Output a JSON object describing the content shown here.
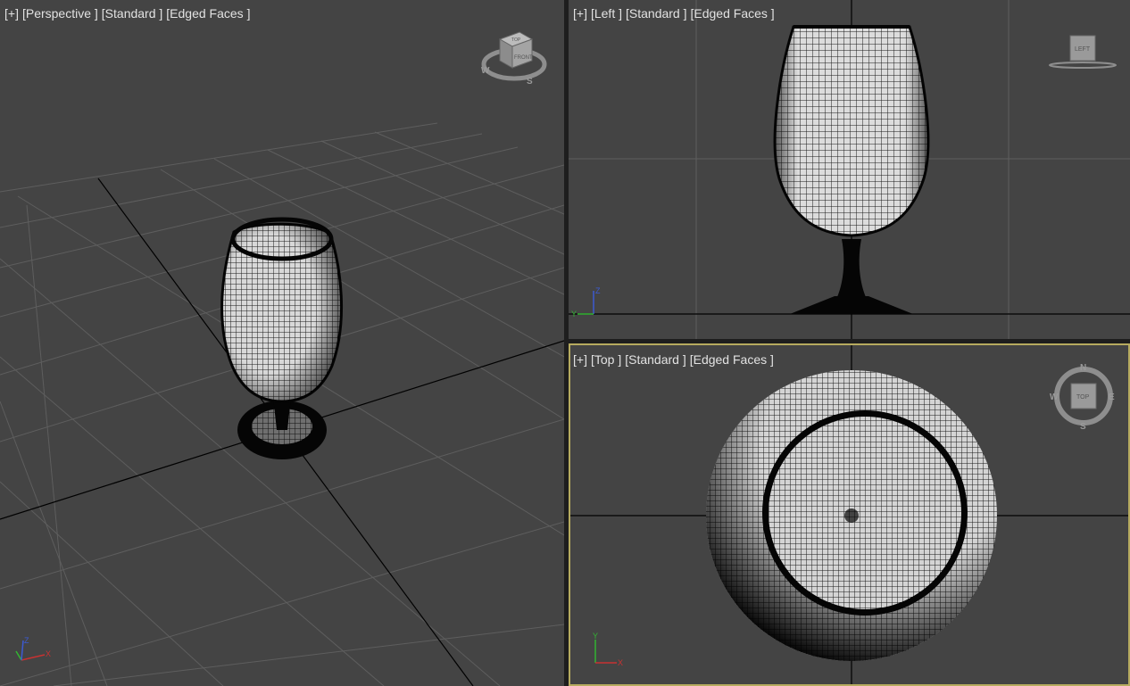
{
  "viewports": {
    "perspective": {
      "menu": "[+]",
      "view": "[Perspective ]",
      "shading": "[Standard ]",
      "mode": "[Edged Faces ]",
      "viewcube": {
        "top": "TOP",
        "front": "FRONT",
        "west": "W",
        "south": "S"
      }
    },
    "left": {
      "menu": "[+]",
      "view": "[Left ]",
      "shading": "[Standard ]",
      "mode": "[Edged Faces ]",
      "viewcube": {
        "face": "LEFT"
      }
    },
    "top": {
      "menu": "[+]",
      "view": "[Top ]",
      "shading": "[Standard ]",
      "mode": "[Edged Faces ]",
      "viewcube": {
        "face": "TOP",
        "north": "N",
        "south": "S",
        "east": "E",
        "west": "W"
      }
    }
  },
  "axes": {
    "x": "X",
    "y": "Y",
    "z": "Z"
  },
  "colors": {
    "viewport_bg": "#444444",
    "grid": "#5c5c5c",
    "grid_main": "#000000",
    "active_border": "#b6ab5f",
    "label": "#e2e2e2",
    "axis_x": "#c83232",
    "axis_y": "#32b432",
    "axis_z": "#3c5ad2"
  }
}
